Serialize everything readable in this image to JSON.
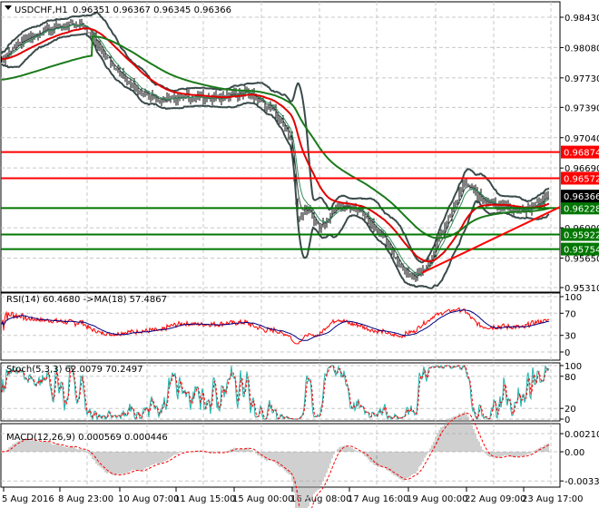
{
  "header": {
    "symbol": "USDCHF,H1",
    "ohlc": "0.96351 0.96367 0.96345 0.96366"
  },
  "colors": {
    "ma_long": "#1a7a1a",
    "ma_mid": "#e00000",
    "bands": "#3a4a4a",
    "price": "#000000",
    "support": "#007700",
    "resistance": "#ff0000",
    "rsi": "#ff0000",
    "rsi_ma": "#000080",
    "stoch_main": "#20b2aa",
    "stoch_signal": "#ff0000"
  },
  "chart_data": [
    {
      "type": "line",
      "title": "USDCHF,H1",
      "ylim": [
        0.9531,
        0.9843
      ],
      "yticks": [
        "0.98430",
        "0.98080",
        "0.97730",
        "0.97390",
        "0.97040",
        "0.96690",
        "0.96000",
        "0.95650",
        "0.95310"
      ],
      "ytick_values": [
        0.9843,
        0.9808,
        0.9773,
        0.9739,
        0.9704,
        0.9669,
        0.96,
        0.9565,
        0.9531
      ],
      "xticks": [
        "5 Aug 2016",
        "8 Aug 23:00",
        "10 Aug 07:00",
        "11 Aug 15:00",
        "15 Aug 00:00",
        "16 Aug 08:00",
        "17 Aug 16:00",
        "19 Aug 00:00",
        "22 Aug 09:00",
        "23 Aug 17:00"
      ],
      "close_anchors": [
        [
          0,
          0.9795
        ],
        [
          20,
          0.9815
        ],
        [
          50,
          0.983
        ],
        [
          90,
          0.9835
        ],
        [
          120,
          0.979
        ],
        [
          150,
          0.976
        ],
        [
          175,
          0.9745
        ],
        [
          200,
          0.9752
        ],
        [
          240,
          0.975
        ],
        [
          270,
          0.9757
        ],
        [
          300,
          0.9735
        ],
        [
          318,
          0.9705
        ],
        [
          326,
          0.961
        ],
        [
          336,
          0.9622
        ],
        [
          350,
          0.96
        ],
        [
          370,
          0.9627
        ],
        [
          395,
          0.962
        ],
        [
          420,
          0.959
        ],
        [
          440,
          0.9555
        ],
        [
          455,
          0.9542
        ],
        [
          470,
          0.956
        ],
        [
          490,
          0.9605
        ],
        [
          510,
          0.9652
        ],
        [
          530,
          0.9632
        ],
        [
          555,
          0.9625
        ],
        [
          575,
          0.9618
        ],
        [
          590,
          0.9628
        ],
        [
          603,
          0.96366
        ]
      ],
      "levels": [
        {
          "label": "0.96874",
          "value": 0.96874,
          "kind": "resistance"
        },
        {
          "label": "0.96572",
          "value": 0.96572,
          "kind": "resistance"
        },
        {
          "label": "0.96228",
          "value": 0.96228,
          "kind": "support"
        },
        {
          "label": "0.95922",
          "value": 0.95922,
          "kind": "support"
        },
        {
          "label": "0.95754",
          "value": 0.95754,
          "kind": "support"
        }
      ],
      "current": {
        "label": "0.96366",
        "value": 0.96366
      },
      "trendline": [
        [
          0.9548
        ],
        [
          0.9624
        ]
      ]
    },
    {
      "type": "line",
      "title": "RSI(14) 60.4680  ->MA(18) 57.4867",
      "ylim": [
        0,
        100
      ],
      "yticks": [
        "100",
        "70",
        "30",
        "0"
      ],
      "ytick_values": [
        100,
        70,
        30,
        0
      ]
    },
    {
      "type": "line",
      "title": "Stoch(5,3,3) 62.0079 70.2497",
      "ylim": [
        0,
        100
      ],
      "yticks": [
        "100",
        "80",
        "20",
        "0"
      ],
      "ytick_values": [
        100,
        80,
        20,
        0
      ]
    },
    {
      "type": "bar",
      "title": "MACD(12,26,9) 0.000569 0.000446",
      "ylim": [
        -0.003389,
        0.002103
      ],
      "yticks": [
        "0.002103",
        "0.00",
        "-0.003389"
      ],
      "ytick_values": [
        0.002103,
        0,
        -0.003389
      ]
    }
  ]
}
